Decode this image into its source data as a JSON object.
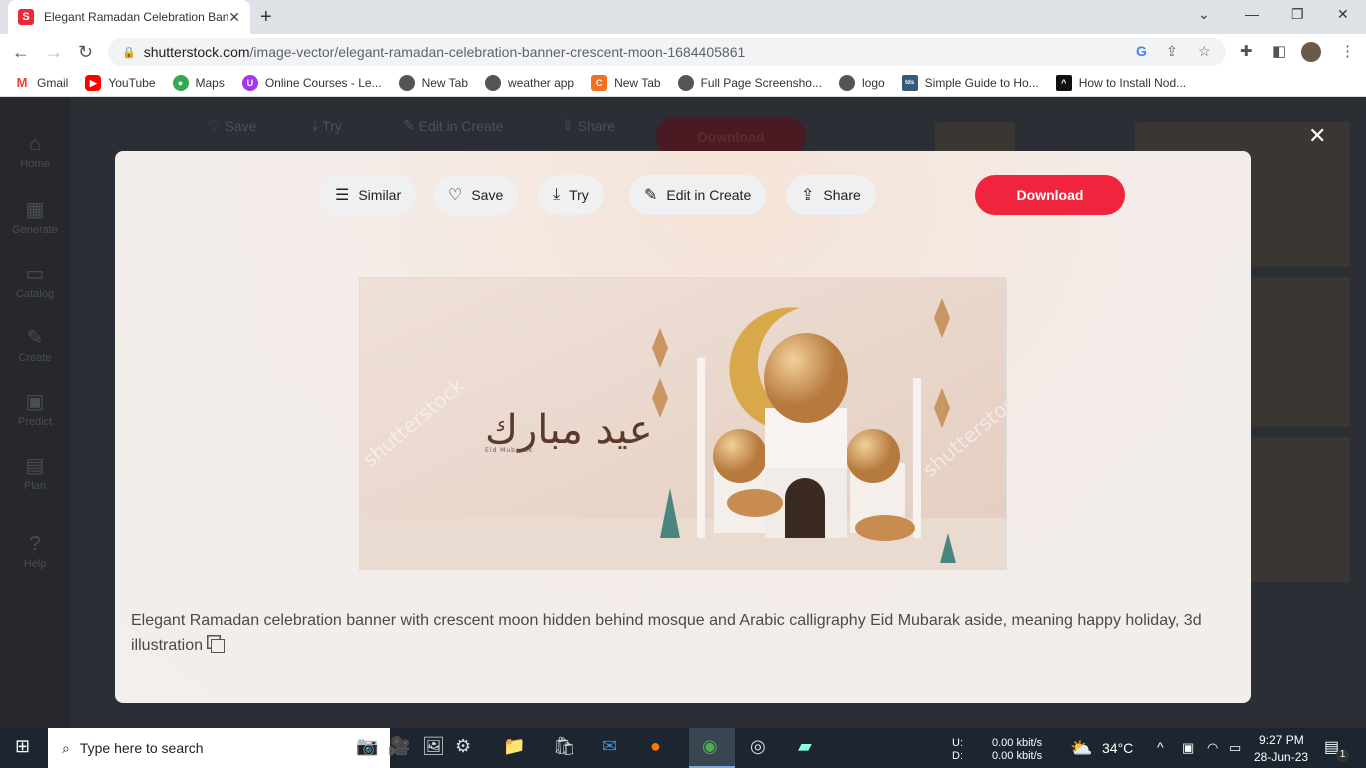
{
  "browser": {
    "tab_title": "Elegant Ramadan Celebration Banner",
    "url_host": "shutterstock.com",
    "url_path": "/image-vector/elegant-ramadan-celebration-banner-crescent-moon-1684405861",
    "bookmarks": [
      "Gmail",
      "YouTube",
      "Maps",
      "Online Courses - Le...",
      "New Tab",
      "weather app",
      "New Tab",
      "Full Page Screensho...",
      "logo",
      "Simple Guide to Ho...",
      "How to Install Nod..."
    ]
  },
  "sidebar": {
    "items": [
      "Home",
      "Generate",
      "Catalog",
      "Create",
      "Predict",
      "Plan",
      "Help"
    ]
  },
  "background_actions": {
    "save": "Save",
    "try": "Try",
    "edit": "Edit in Create",
    "share": "Share",
    "download": "Download"
  },
  "modal": {
    "actions": {
      "similar": "Similar",
      "save": "Save",
      "try": "Try",
      "edit": "Edit in Create",
      "share": "Share",
      "download": "Download"
    },
    "image": {
      "calligraphy": "عيد مبارك",
      "caption": "Eid Mubarak",
      "watermark": "shutterstock"
    },
    "description": "Elegant Ramadan celebration banner with crescent moon hidden behind mosque and Arabic calligraphy Eid Mubarak aside, meaning happy holiday, 3d illustration"
  },
  "taskbar": {
    "search_placeholder": "Type here to search",
    "net_up_label": "U:",
    "net_down_label": "D:",
    "net_up": "0.00 kbit/s",
    "net_down": "0.00 kbit/s",
    "temp": "34°C",
    "time": "9:27 PM",
    "date": "28-Jun-23",
    "notifications": "1"
  },
  "colors": {
    "accent": "#f0243d"
  }
}
